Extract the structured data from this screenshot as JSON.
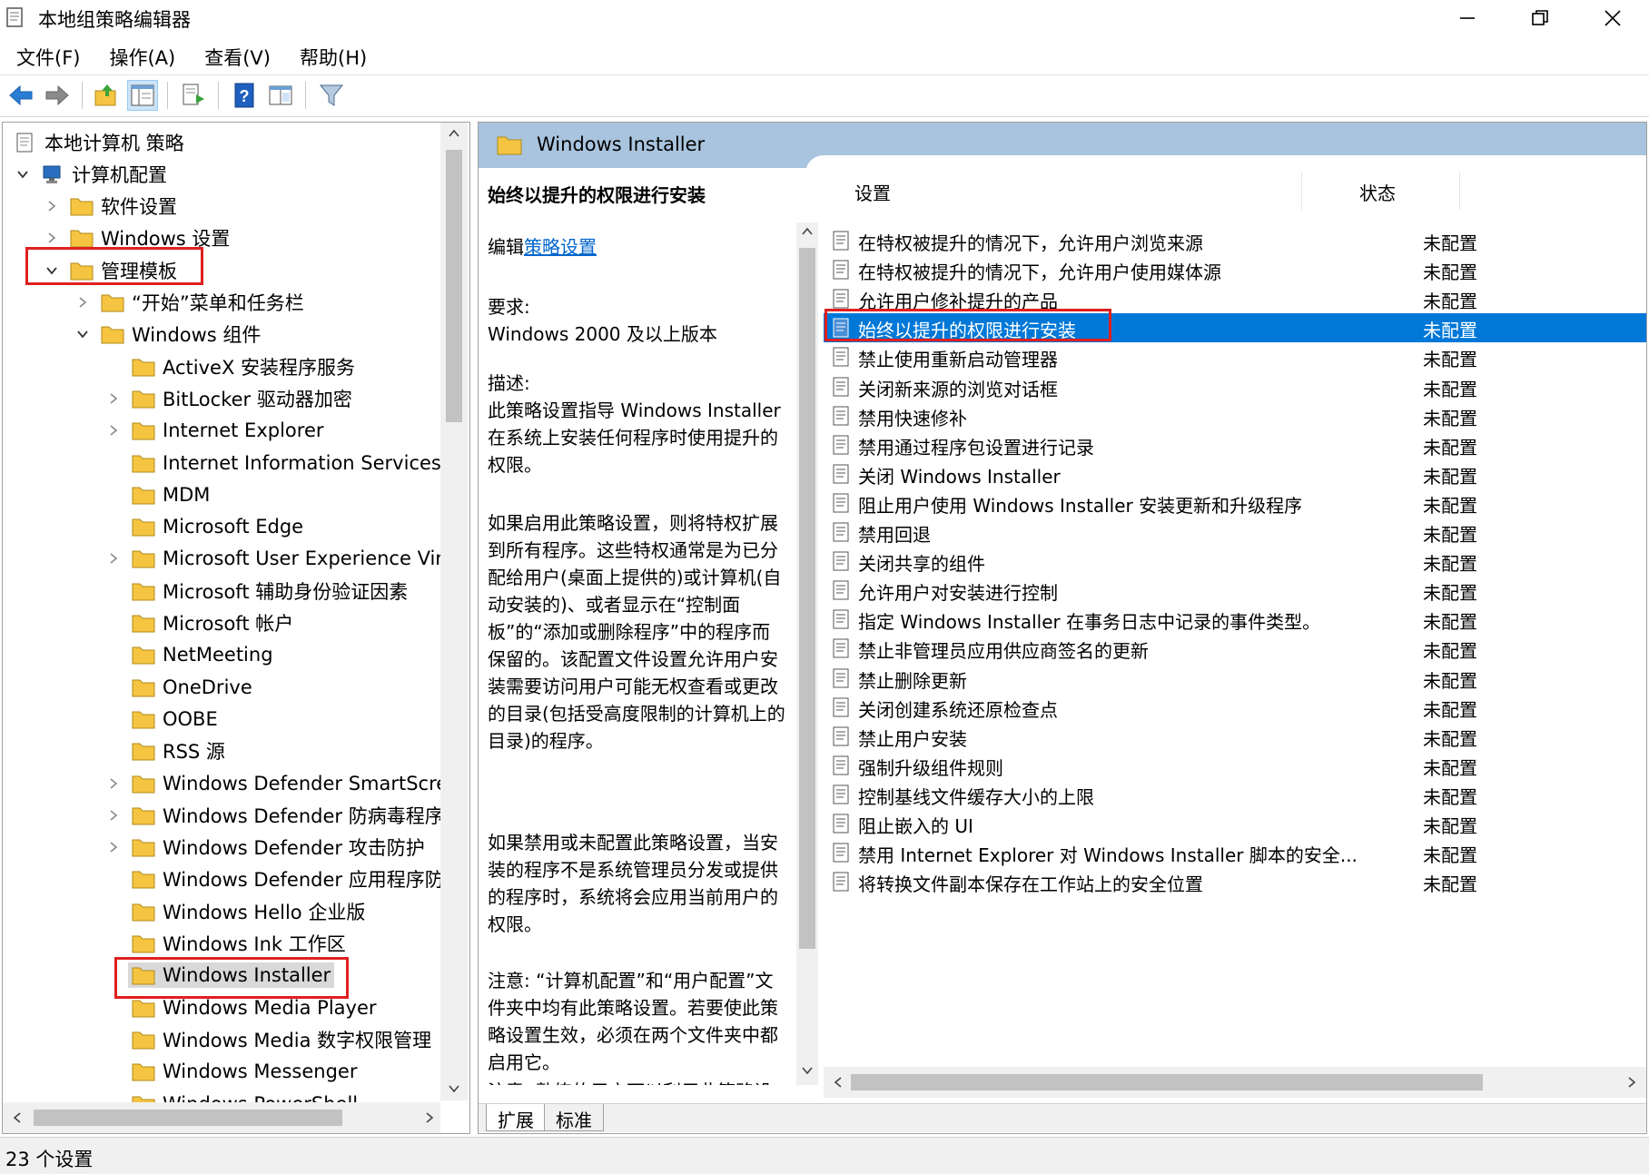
{
  "window": {
    "title": "本地组策略编辑器",
    "minimize_icon": "minimize-icon",
    "restore_icon": "restore-icon",
    "close_icon": "close-icon"
  },
  "menu": [
    "文件(F)",
    "操作(A)",
    "查看(V)",
    "帮助(H)"
  ],
  "toolbar": {
    "buttons": [
      "back-arrow-icon",
      "forward-arrow-icon",
      "up-folder-icon",
      "show-hide-tree-icon",
      "export-list-icon",
      "help-icon",
      "extended-view-icon",
      "filter-icon"
    ]
  },
  "tree": {
    "items": [
      {
        "label": "本地计算机 策略",
        "level": 0,
        "expand": "none",
        "icon": "policy-doc-icon"
      },
      {
        "label": "计算机配置",
        "level": 1,
        "expand": "open",
        "icon": "computer-icon"
      },
      {
        "label": "软件设置",
        "level": 2,
        "expand": "closed",
        "icon": "folder-icon"
      },
      {
        "label": "Windows 设置",
        "level": 2,
        "expand": "closed",
        "icon": "folder-icon"
      },
      {
        "label": "管理模板",
        "level": 2,
        "expand": "open",
        "icon": "folder-icon"
      },
      {
        "label": "“开始”菜单和任务栏",
        "level": 3,
        "expand": "closed",
        "icon": "folder-icon"
      },
      {
        "label": "Windows 组件",
        "level": 3,
        "expand": "open",
        "icon": "folder-icon"
      },
      {
        "label": "ActiveX 安装程序服务",
        "level": 4,
        "expand": "none",
        "icon": "folder-icon"
      },
      {
        "label": "BitLocker 驱动器加密",
        "level": 4,
        "expand": "closed",
        "icon": "folder-icon"
      },
      {
        "label": "Internet Explorer",
        "level": 4,
        "expand": "closed",
        "icon": "folder-icon"
      },
      {
        "label": "Internet Information Services",
        "level": 4,
        "expand": "none",
        "icon": "folder-icon"
      },
      {
        "label": "MDM",
        "level": 4,
        "expand": "none",
        "icon": "folder-icon"
      },
      {
        "label": "Microsoft Edge",
        "level": 4,
        "expand": "none",
        "icon": "folder-icon"
      },
      {
        "label": "Microsoft User Experience Vir",
        "level": 4,
        "expand": "closed",
        "icon": "folder-icon"
      },
      {
        "label": "Microsoft 辅助身份验证因素",
        "level": 4,
        "expand": "none",
        "icon": "folder-icon"
      },
      {
        "label": "Microsoft 帐户",
        "level": 4,
        "expand": "none",
        "icon": "folder-icon"
      },
      {
        "label": "NetMeeting",
        "level": 4,
        "expand": "none",
        "icon": "folder-icon"
      },
      {
        "label": "OneDrive",
        "level": 4,
        "expand": "none",
        "icon": "folder-icon"
      },
      {
        "label": "OOBE",
        "level": 4,
        "expand": "none",
        "icon": "folder-icon"
      },
      {
        "label": "RSS 源",
        "level": 4,
        "expand": "none",
        "icon": "folder-icon"
      },
      {
        "label": "Windows Defender SmartScre",
        "level": 4,
        "expand": "closed",
        "icon": "folder-icon"
      },
      {
        "label": "Windows Defender 防病毒程序",
        "level": 4,
        "expand": "closed",
        "icon": "folder-icon"
      },
      {
        "label": "Windows Defender 攻击防护",
        "level": 4,
        "expand": "closed",
        "icon": "folder-icon"
      },
      {
        "label": "Windows Defender 应用程序防",
        "level": 4,
        "expand": "none",
        "icon": "folder-icon"
      },
      {
        "label": "Windows Hello 企业版",
        "level": 4,
        "expand": "none",
        "icon": "folder-icon"
      },
      {
        "label": "Windows Ink 工作区",
        "level": 4,
        "expand": "none",
        "icon": "folder-icon"
      },
      {
        "label": "Windows Installer",
        "level": 4,
        "expand": "none",
        "icon": "folder-icon",
        "selected": true
      },
      {
        "label": "Windows Media Player",
        "level": 4,
        "expand": "none",
        "icon": "folder-icon"
      },
      {
        "label": "Windows Media 数字权限管理",
        "level": 4,
        "expand": "none",
        "icon": "folder-icon"
      },
      {
        "label": "Windows Messenger",
        "level": 4,
        "expand": "none",
        "icon": "folder-icon"
      },
      {
        "label": "Windows PowerShell",
        "level": 4,
        "expand": "none",
        "icon": "folder-icon"
      }
    ]
  },
  "content": {
    "header_title": "Windows Installer",
    "description": {
      "title": "始终以提升的权限进行安装",
      "edit_prefix": "编辑",
      "edit_link": "策略设置",
      "requirement_label": "要求:",
      "requirement_value": "Windows 2000 及以上版本",
      "desc_label": "描述:",
      "desc_text": "此策略设置指导 Windows Installer 在系统上安装任何程序时使用提升的权限。",
      "para1": "如果启用此策略设置，则将特权扩展到所有程序。这些特权通常是为已分配给用户(桌面上提供的)或计算机(自动安装的)、或者显示在“控制面板”的“添加或删除程序”中的程序而保留的。该配置文件设置允许用户安装需要访问用户可能无权查看或更改的目录(包括受高度限制的计算机上的目录)的程序。",
      "para2": "如果禁用或未配置此策略设置，当安装的程序不是系统管理员分发或提供的程序时，系统将会应用当前用户的权限。",
      "para3": "注意: “计算机配置”和“用户配置”文件夹中均有此策略设置。若要使此策略设置生效，必须在两个文件夹中都启用它。",
      "para4": "注意: 熟练的用户可以利用此策略设置授予的权限来更改其特权并获"
    },
    "columns": {
      "setting": "设置",
      "state": "状态"
    },
    "settings": [
      {
        "name": "在特权被提升的情况下，允许用户浏览来源",
        "state": "未配置"
      },
      {
        "name": "在特权被提升的情况下，允许用户使用媒体源",
        "state": "未配置"
      },
      {
        "name": "允许用户修补提升的产品",
        "state": "未配置"
      },
      {
        "name": "始终以提升的权限进行安装",
        "state": "未配置",
        "selected": true
      },
      {
        "name": "禁止使用重新启动管理器",
        "state": "未配置"
      },
      {
        "name": "关闭新来源的浏览对话框",
        "state": "未配置"
      },
      {
        "name": "禁用快速修补",
        "state": "未配置"
      },
      {
        "name": "禁用通过程序包设置进行记录",
        "state": "未配置"
      },
      {
        "name": "关闭 Windows Installer",
        "state": "未配置"
      },
      {
        "name": "阻止用户使用 Windows Installer 安装更新和升级程序",
        "state": "未配置"
      },
      {
        "name": "禁用回退",
        "state": "未配置"
      },
      {
        "name": "关闭共享的组件",
        "state": "未配置"
      },
      {
        "name": "允许用户对安装进行控制",
        "state": "未配置"
      },
      {
        "name": "指定 Windows Installer 在事务日志中记录的事件类型。",
        "state": "未配置"
      },
      {
        "name": "禁止非管理员应用供应商签名的更新",
        "state": "未配置"
      },
      {
        "name": "禁止删除更新",
        "state": "未配置"
      },
      {
        "name": "关闭创建系统还原检查点",
        "state": "未配置"
      },
      {
        "name": "禁止用户安装",
        "state": "未配置"
      },
      {
        "name": "强制升级组件规则",
        "state": "未配置"
      },
      {
        "name": "控制基线文件缓存大小的上限",
        "state": "未配置"
      },
      {
        "name": "阻止嵌入的 UI",
        "state": "未配置"
      },
      {
        "name": "禁用 Internet Explorer 对 Windows Installer 脚本的安全...",
        "state": "未配置"
      },
      {
        "name": "将转换文件副本保存在工作站上的安全位置",
        "state": "未配置"
      }
    ],
    "tabs": [
      "扩展",
      "标准"
    ]
  },
  "status": {
    "text": "23 个设置"
  },
  "colors": {
    "accent": "#0078d7",
    "header_bg": "#a9c4de",
    "highlight_border": "#e02020",
    "folder": "#f5c542"
  }
}
